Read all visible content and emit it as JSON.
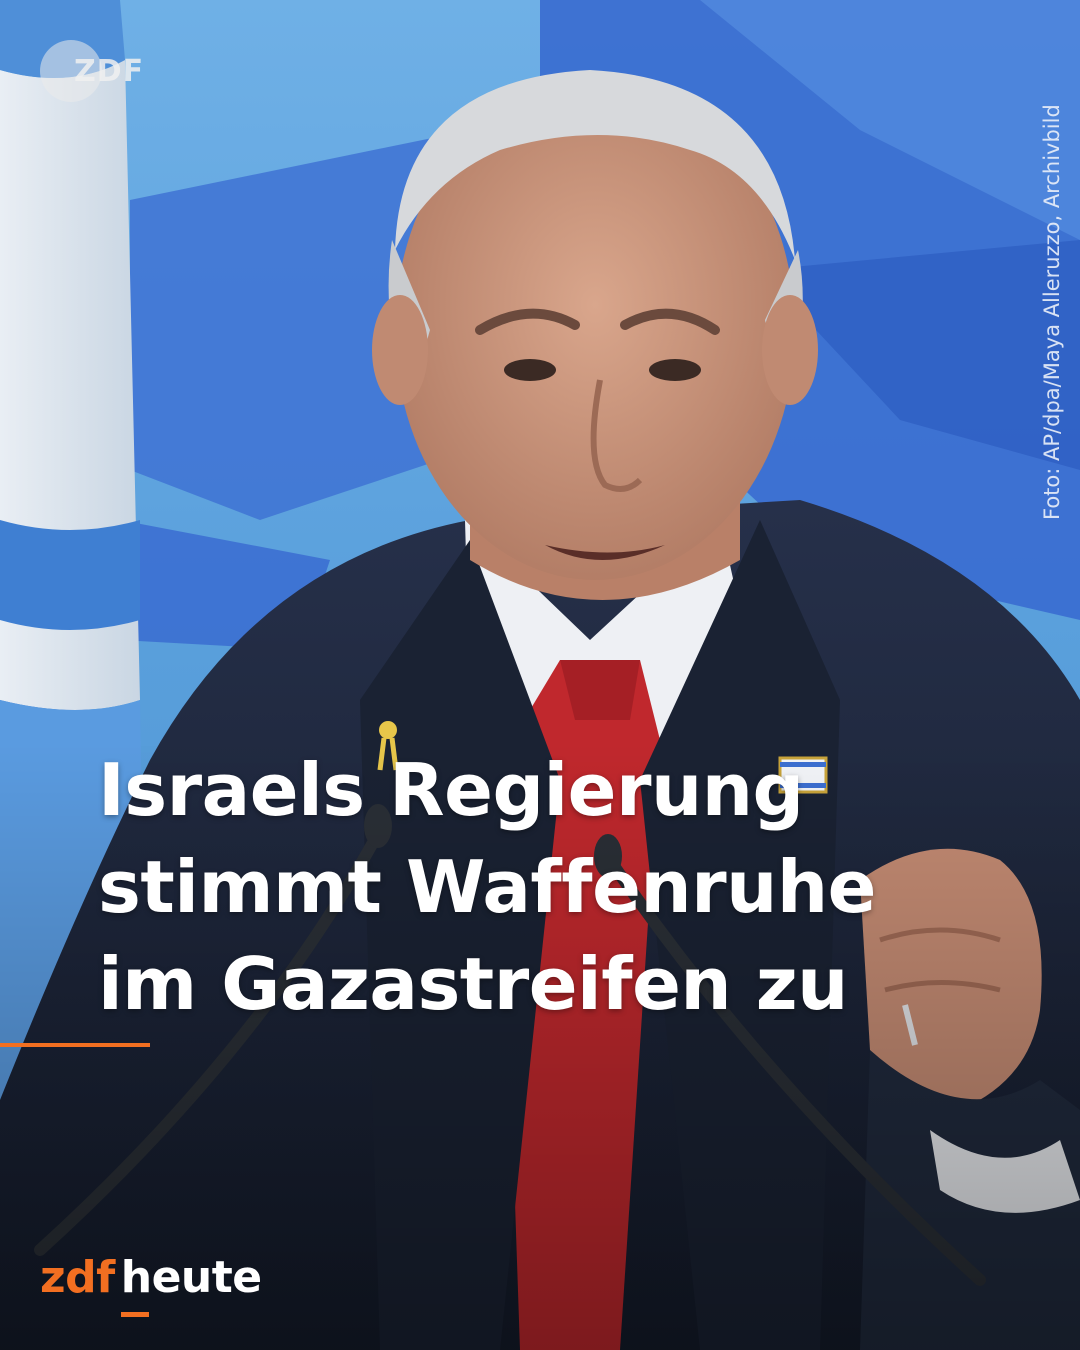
{
  "badge": {
    "logo_text": "ZDF",
    "icon": "zdf-circle-icon"
  },
  "credit": {
    "text": "Foto: AP/dpa/Maya Alleruzzo, Archivbild"
  },
  "headline": {
    "lines": [
      "Israels Regierung",
      "stimmt Waffenruhe",
      "im Gazastreifen zu"
    ]
  },
  "brand": {
    "part1": "zdf",
    "part2": "heute"
  },
  "colors": {
    "accent": "#f26f21",
    "headline_text": "#ffffff",
    "background_blue": "#5aa0dc",
    "flag_blue": "#3b6fd0",
    "suit": "#1d2636",
    "tie": "#c0282d"
  }
}
